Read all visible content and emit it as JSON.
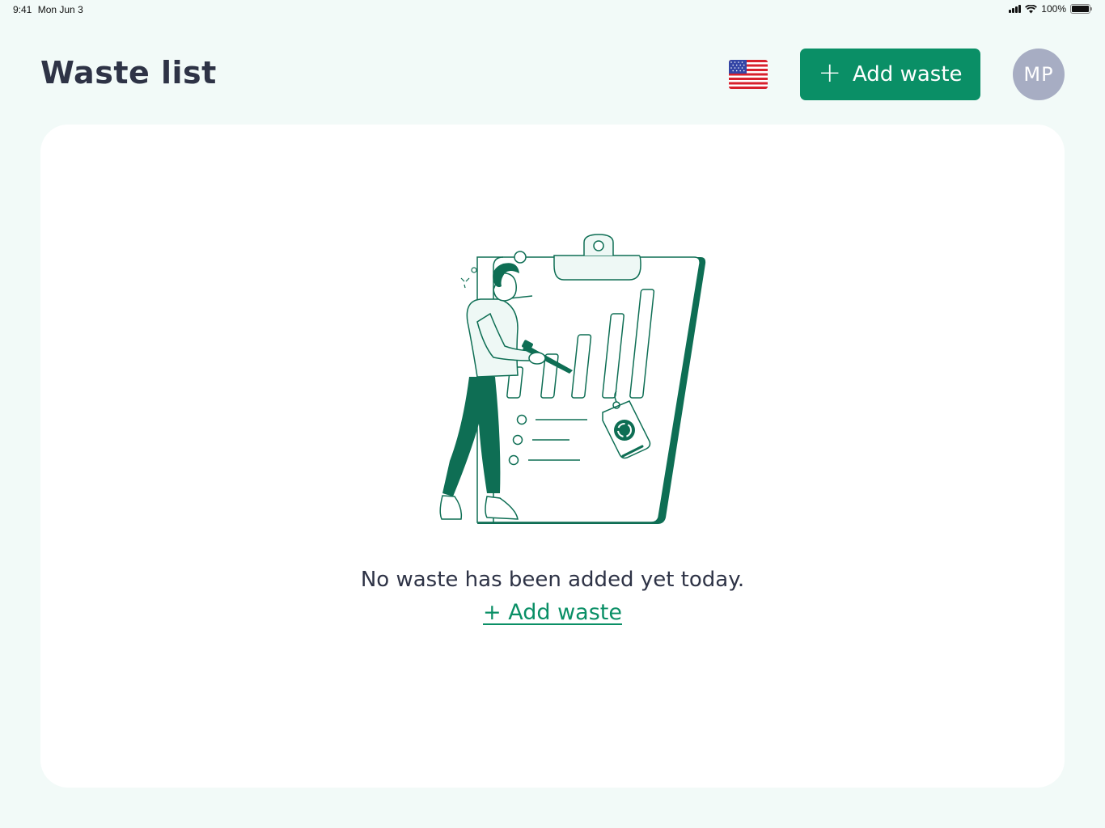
{
  "status_bar": {
    "time": "9:41",
    "date": "Mon Jun 3",
    "battery": "100%"
  },
  "header": {
    "title": "Waste list",
    "language_flag": "us-flag-icon",
    "add_button_label": "Add waste",
    "avatar_initials": "MP"
  },
  "empty_state": {
    "illustration": "person-clipboard-chart-illustration",
    "message": "No waste has been added yet today.",
    "add_link": "+ Add waste"
  },
  "colors": {
    "accent": "#0a8f66",
    "illustration_dark": "#0e6e54",
    "background": "#f2faf8",
    "avatar": "#a7adc3"
  }
}
